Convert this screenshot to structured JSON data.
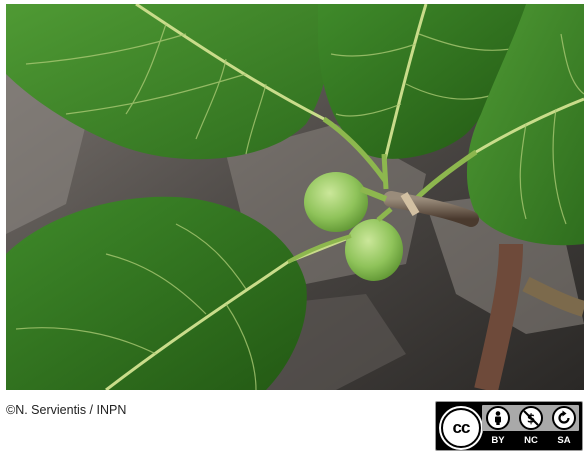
{
  "photo": {
    "subject": "fig-branch-with-leaves-and-green-fruits"
  },
  "credit": {
    "text": "©N. Servientis / INPN"
  },
  "license": {
    "main_symbol": "cc",
    "terms": [
      {
        "icon": "by-person-icon",
        "label": "BY"
      },
      {
        "icon": "nc-dollar-icon",
        "label": "NC"
      },
      {
        "icon": "sa-share-icon",
        "label": "SA"
      }
    ]
  }
}
